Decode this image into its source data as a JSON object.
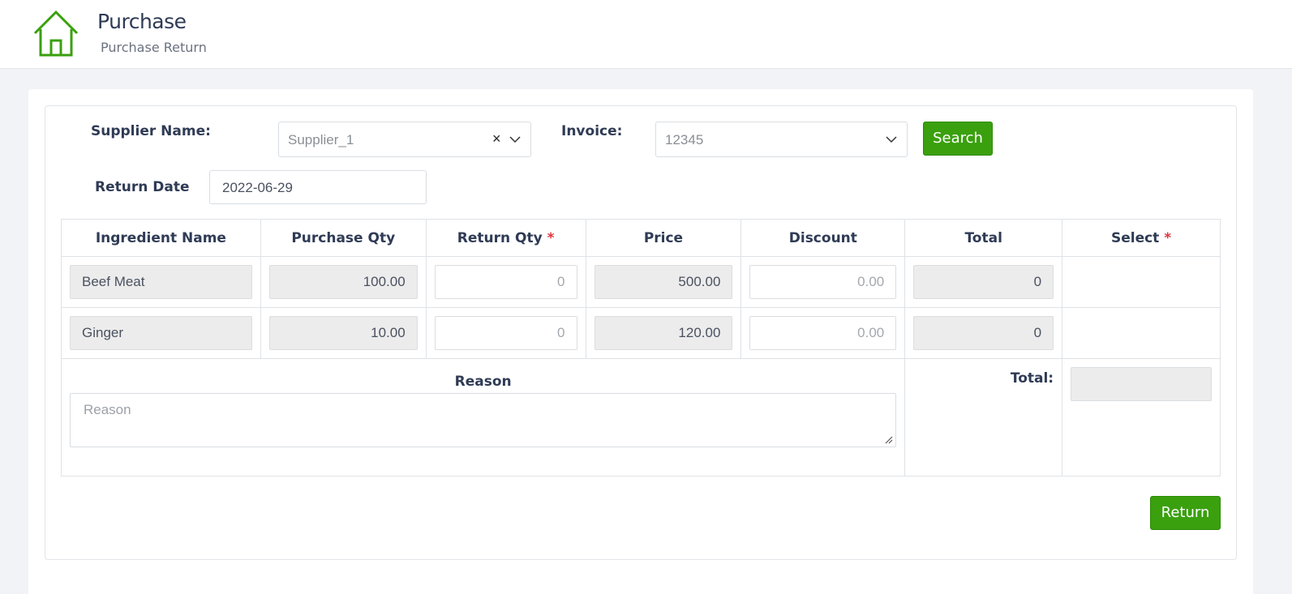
{
  "header": {
    "title": "Purchase",
    "subtitle": "Purchase Return",
    "icon": "home-icon",
    "accent_color": "#3aa00e"
  },
  "form": {
    "supplier_label": "Supplier Name:",
    "supplier_value": "Supplier_1",
    "invoice_label": "Invoice:",
    "invoice_value": "12345",
    "search_label": "Search",
    "return_date_label": "Return Date",
    "return_date_value": "2022-06-29"
  },
  "table": {
    "headers": {
      "ingredient": "Ingredient Name",
      "purchase_qty": "Purchase Qty",
      "return_qty": "Return Qty",
      "price": "Price",
      "discount": "Discount",
      "total": "Total",
      "select": "Select",
      "required_mark": "*"
    },
    "rows": [
      {
        "ingredient": "Beef Meat",
        "purchase_qty": "100.00",
        "return_qty": "0",
        "price": "500.00",
        "discount": "0.00",
        "total": "0"
      },
      {
        "ingredient": "Ginger",
        "purchase_qty": "10.00",
        "return_qty": "0",
        "price": "120.00",
        "discount": "0.00",
        "total": "0"
      }
    ],
    "reason_label": "Reason",
    "reason_placeholder": "Reason",
    "total_label": "Total:",
    "grand_total": ""
  },
  "actions": {
    "return_label": "Return"
  }
}
